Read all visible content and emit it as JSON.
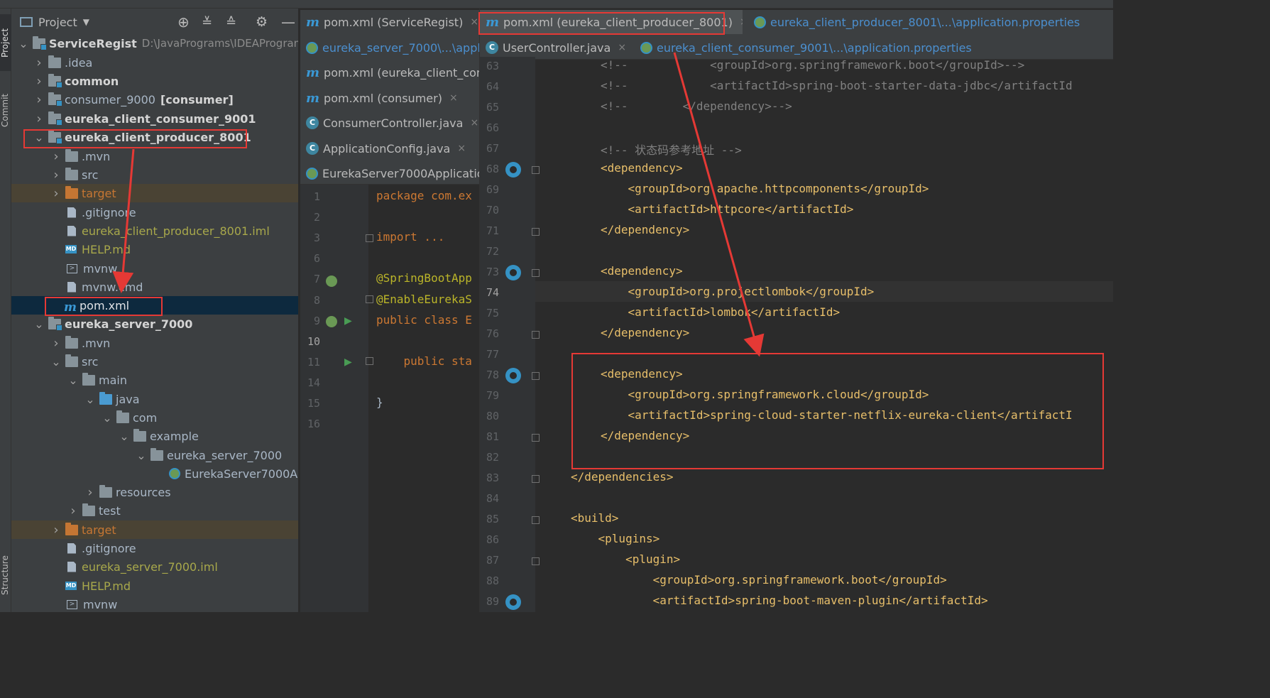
{
  "left_strip": {
    "project_tab": "Project",
    "commit_tab": "Commit",
    "structure_tab": "Structure"
  },
  "project_panel": {
    "title": "Project",
    "tree": [
      {
        "label": "ServiceRegist",
        "suffix": "D:\\JavaPrograms\\IDEAProgram",
        "icon": "module-folder-icon",
        "arrow": "down",
        "style": "bold"
      },
      {
        "label": ".idea",
        "icon": "folder-icon",
        "arrow": "right",
        "style": "normal"
      },
      {
        "label": "common",
        "icon": "module-folder-icon",
        "arrow": "right",
        "style": "bold"
      },
      {
        "label": "consumer_9000",
        "suffix": "[consumer]",
        "icon": "module-folder-icon",
        "arrow": "right",
        "style": "normal"
      },
      {
        "label": "eureka_client_consumer_9001",
        "icon": "module-folder-icon",
        "arrow": "right",
        "style": "bold"
      },
      {
        "label": "eureka_client_producer_8001",
        "icon": "module-folder-icon",
        "arrow": "down",
        "style": "bold"
      },
      {
        "label": ".mvn",
        "icon": "folder-icon",
        "arrow": "right",
        "style": "normal"
      },
      {
        "label": "src",
        "icon": "folder-icon",
        "arrow": "right",
        "style": "normal"
      },
      {
        "label": "target",
        "icon": "excluded-folder-icon",
        "arrow": "right",
        "style": "excluded"
      },
      {
        "label": ".gitignore",
        "icon": "gitignore-file-icon",
        "style": "normal"
      },
      {
        "label": "eureka_client_producer_8001.iml",
        "icon": "iml-file-icon",
        "style": "olive"
      },
      {
        "label": "HELP.md",
        "icon": "markdown-file-icon",
        "style": "olive"
      },
      {
        "label": "mvnw",
        "icon": "shell-script-icon",
        "style": "normal"
      },
      {
        "label": "mvnw.cmd",
        "icon": "text-file-icon",
        "style": "normal"
      },
      {
        "label": "pom.xml",
        "icon": "maven-file-icon",
        "style": "selected"
      },
      {
        "label": "eureka_server_7000",
        "icon": "module-folder-icon",
        "arrow": "down",
        "style": "bold"
      },
      {
        "label": ".mvn",
        "icon": "folder-icon",
        "arrow": "right",
        "style": "normal"
      },
      {
        "label": "src",
        "icon": "folder-icon",
        "arrow": "down",
        "style": "normal"
      },
      {
        "label": "main",
        "icon": "folder-icon",
        "arrow": "down",
        "style": "normal"
      },
      {
        "label": "java",
        "icon": "source-folder-icon",
        "arrow": "down",
        "style": "normal"
      },
      {
        "label": "com",
        "icon": "package-icon",
        "arrow": "down",
        "style": "normal"
      },
      {
        "label": "example",
        "icon": "package-icon",
        "arrow": "down",
        "style": "normal"
      },
      {
        "label": "eureka_server_7000",
        "icon": "package-icon",
        "arrow": "down",
        "style": "normal"
      },
      {
        "label": "EurekaServer7000Ap",
        "icon": "spring-boot-class-icon",
        "style": "normal"
      },
      {
        "label": "resources",
        "icon": "resources-folder-icon",
        "arrow": "right",
        "style": "normal"
      },
      {
        "label": "test",
        "icon": "folder-icon",
        "arrow": "right",
        "style": "normal"
      },
      {
        "label": "target",
        "icon": "excluded-folder-icon",
        "arrow": "right",
        "style": "excluded"
      },
      {
        "label": ".gitignore",
        "icon": "gitignore-file-icon",
        "style": "normal"
      },
      {
        "label": "eureka_server_7000.iml",
        "icon": "iml-file-icon",
        "style": "olive"
      },
      {
        "label": "HELP.md",
        "icon": "markdown-file-icon",
        "style": "olive"
      },
      {
        "label": "mvnw",
        "icon": "shell-script-icon",
        "style": "normal"
      }
    ]
  },
  "left_tabs": [
    {
      "label": "pom.xml (ServiceRegist)",
      "icon": "maven-icon",
      "style": "normal"
    },
    {
      "label": "eureka_server_7000\\...\\appli",
      "icon": "spring-config-icon",
      "style": "blue"
    },
    {
      "label": "pom.xml (eureka_client_cons",
      "icon": "maven-icon",
      "style": "normal"
    },
    {
      "label": "pom.xml (consumer)",
      "icon": "maven-icon",
      "style": "normal"
    },
    {
      "label": "ConsumerController.java",
      "icon": "class-icon",
      "style": "normal"
    },
    {
      "label": "ApplicationConfig.java",
      "icon": "class-icon",
      "style": "normal"
    },
    {
      "label": "EurekaServer7000Applicatio",
      "icon": "spring-boot-class-icon",
      "style": "normal"
    }
  ],
  "right_tabs": [
    {
      "label": "pom.xml (eureka_client_producer_8001)",
      "icon": "maven-icon",
      "style": "active"
    },
    {
      "label": "eureka_client_producer_8001\\...\\application.properties",
      "icon": "spring-config-icon",
      "style": "blue"
    },
    {
      "label": "UserController.java",
      "icon": "class-icon",
      "style": "normal"
    },
    {
      "label": "eureka_client_consumer_9001\\...\\application.properties",
      "icon": "spring-config-icon",
      "style": "blue"
    }
  ],
  "left_editor": {
    "lines": [
      {
        "num": "1",
        "text": "package com.ex"
      },
      {
        "num": "2",
        "text": ""
      },
      {
        "num": "3",
        "text": "import ..."
      },
      {
        "num": "6",
        "text": ""
      },
      {
        "num": "7",
        "text": "@SpringBootApp"
      },
      {
        "num": "8",
        "text": "@EnableEurekaS"
      },
      {
        "num": "9",
        "text": "public class E"
      },
      {
        "num": "10",
        "text": ""
      },
      {
        "num": "11",
        "text": "    public sta"
      },
      {
        "num": "14",
        "text": ""
      },
      {
        "num": "15",
        "text": "}"
      },
      {
        "num": "16",
        "text": ""
      }
    ]
  },
  "right_editor": {
    "lines": [
      {
        "num": "63",
        "text": "<!--            <groupId>org.springframework.boot</groupId>-->"
      },
      {
        "num": "64",
        "text": "<!--            <artifactId>spring-boot-starter-data-jdbc</artifactId"
      },
      {
        "num": "65",
        "text": "<!--        </dependency>-->"
      },
      {
        "num": "66",
        "text": ""
      },
      {
        "num": "67",
        "text": "<!-- 状态码参考地址 -->"
      },
      {
        "num": "68",
        "text": "<dependency>"
      },
      {
        "num": "69",
        "text": "    <groupId>org.apache.httpcomponents</groupId>"
      },
      {
        "num": "70",
        "text": "    <artifactId>httpcore</artifactId>"
      },
      {
        "num": "71",
        "text": "</dependency>"
      },
      {
        "num": "72",
        "text": ""
      },
      {
        "num": "73",
        "text": "<dependency>"
      },
      {
        "num": "74",
        "text": "    <groupId>org.projectlombok</groupId>"
      },
      {
        "num": "75",
        "text": "    <artifactId>lombok</artifactId>"
      },
      {
        "num": "76",
        "text": "</dependency>"
      },
      {
        "num": "77",
        "text": ""
      },
      {
        "num": "78",
        "text": "<dependency>"
      },
      {
        "num": "79",
        "text": "    <groupId>org.springframework.cloud</groupId>"
      },
      {
        "num": "80",
        "text": "    <artifactId>spring-cloud-starter-netflix-eureka-client</artifactI"
      },
      {
        "num": "81",
        "text": "</dependency>"
      },
      {
        "num": "82",
        "text": ""
      },
      {
        "num": "83",
        "text": "</dependencies>"
      },
      {
        "num": "84",
        "text": ""
      },
      {
        "num": "85",
        "text": "<build>"
      },
      {
        "num": "86",
        "text": "    <plugins>"
      },
      {
        "num": "87",
        "text": "        <plugin>"
      },
      {
        "num": "88",
        "text": "            <groupId>org.springframework.boot</groupId>"
      },
      {
        "num": "89",
        "text": "            <artifactId>spring-boot-maven-plugin</artifactId>"
      }
    ]
  },
  "colors": {
    "annotation_red": "#e53935",
    "tag": "#e8bf6a",
    "comment": "#808080",
    "keyword": "#cc7832"
  }
}
